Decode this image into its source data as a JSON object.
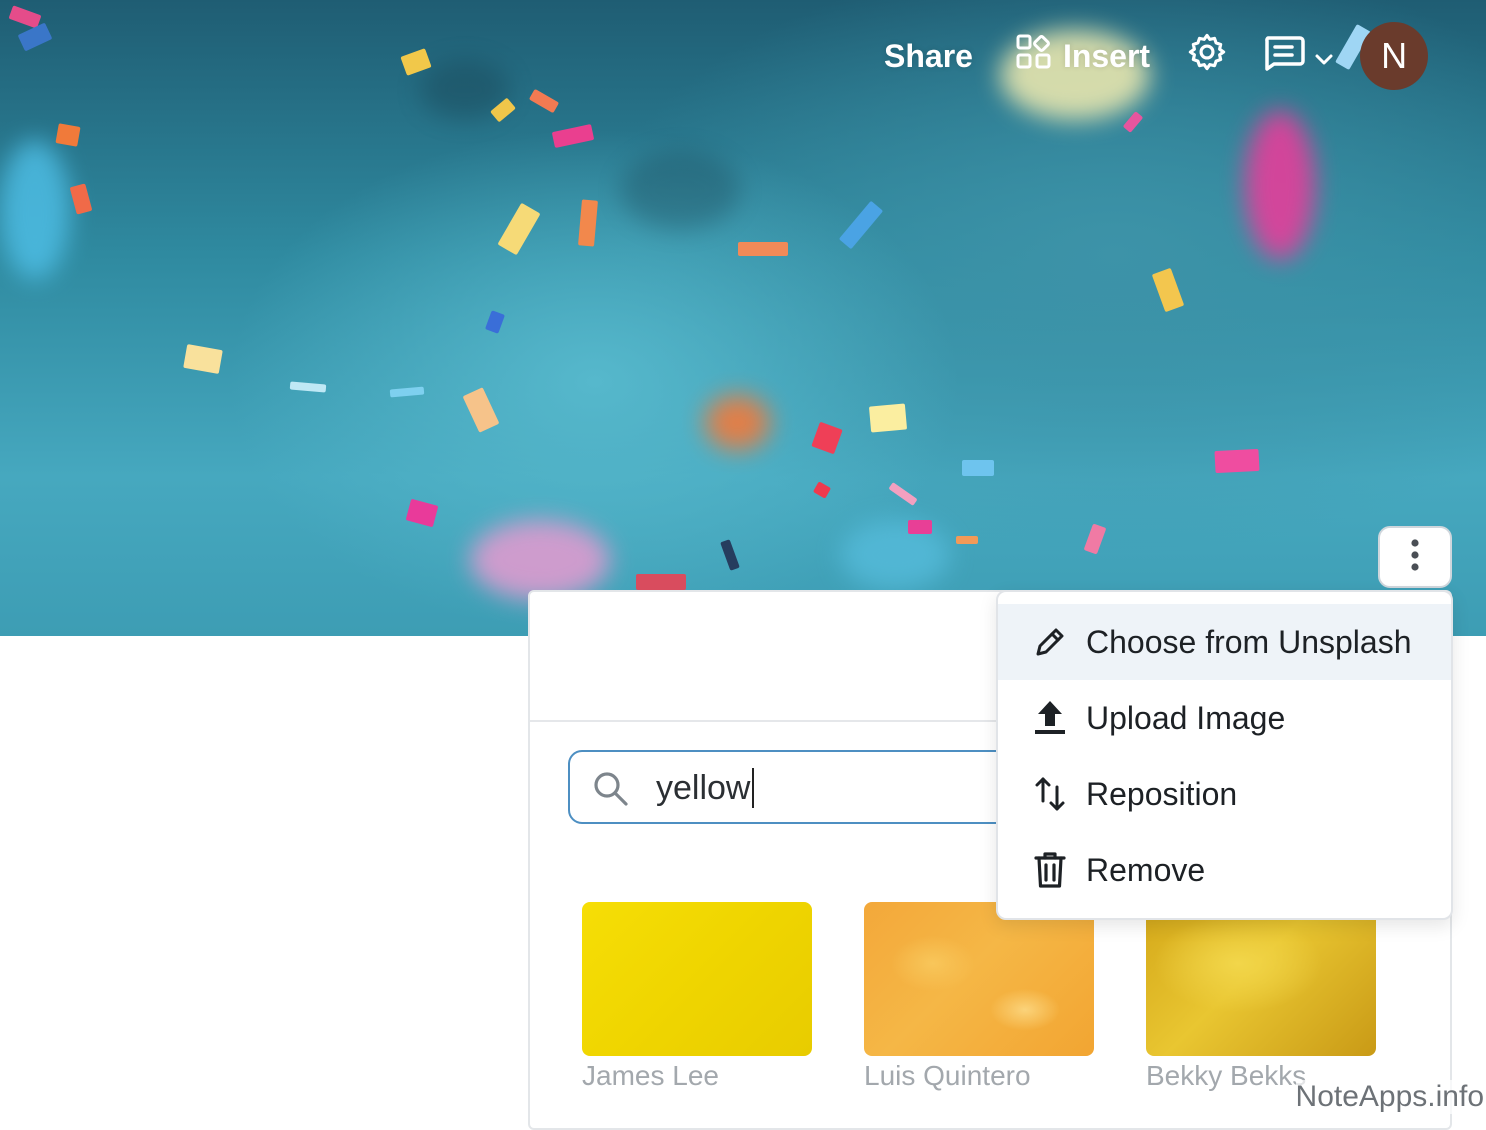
{
  "toolbar": {
    "share_label": "Share",
    "insert_label": "Insert",
    "avatar_initial": "N"
  },
  "picker": {
    "search_value": "yellow",
    "results": [
      {
        "author": "James Lee"
      },
      {
        "author": "Luis Quintero"
      },
      {
        "author": "Bekky Bekks"
      }
    ]
  },
  "menu": {
    "items": [
      {
        "label": "Choose from Unsplash",
        "icon": "pencil-icon"
      },
      {
        "label": "Upload Image",
        "icon": "upload-icon"
      },
      {
        "label": "Reposition",
        "icon": "reposition-icon"
      },
      {
        "label": "Remove",
        "icon": "trash-icon"
      }
    ]
  },
  "watermark": "NoteApps.info",
  "colors": {
    "search_border": "#4d8fc2",
    "menu_active_bg": "#eef3f8",
    "avatar_bg": "#6a3b2c"
  }
}
